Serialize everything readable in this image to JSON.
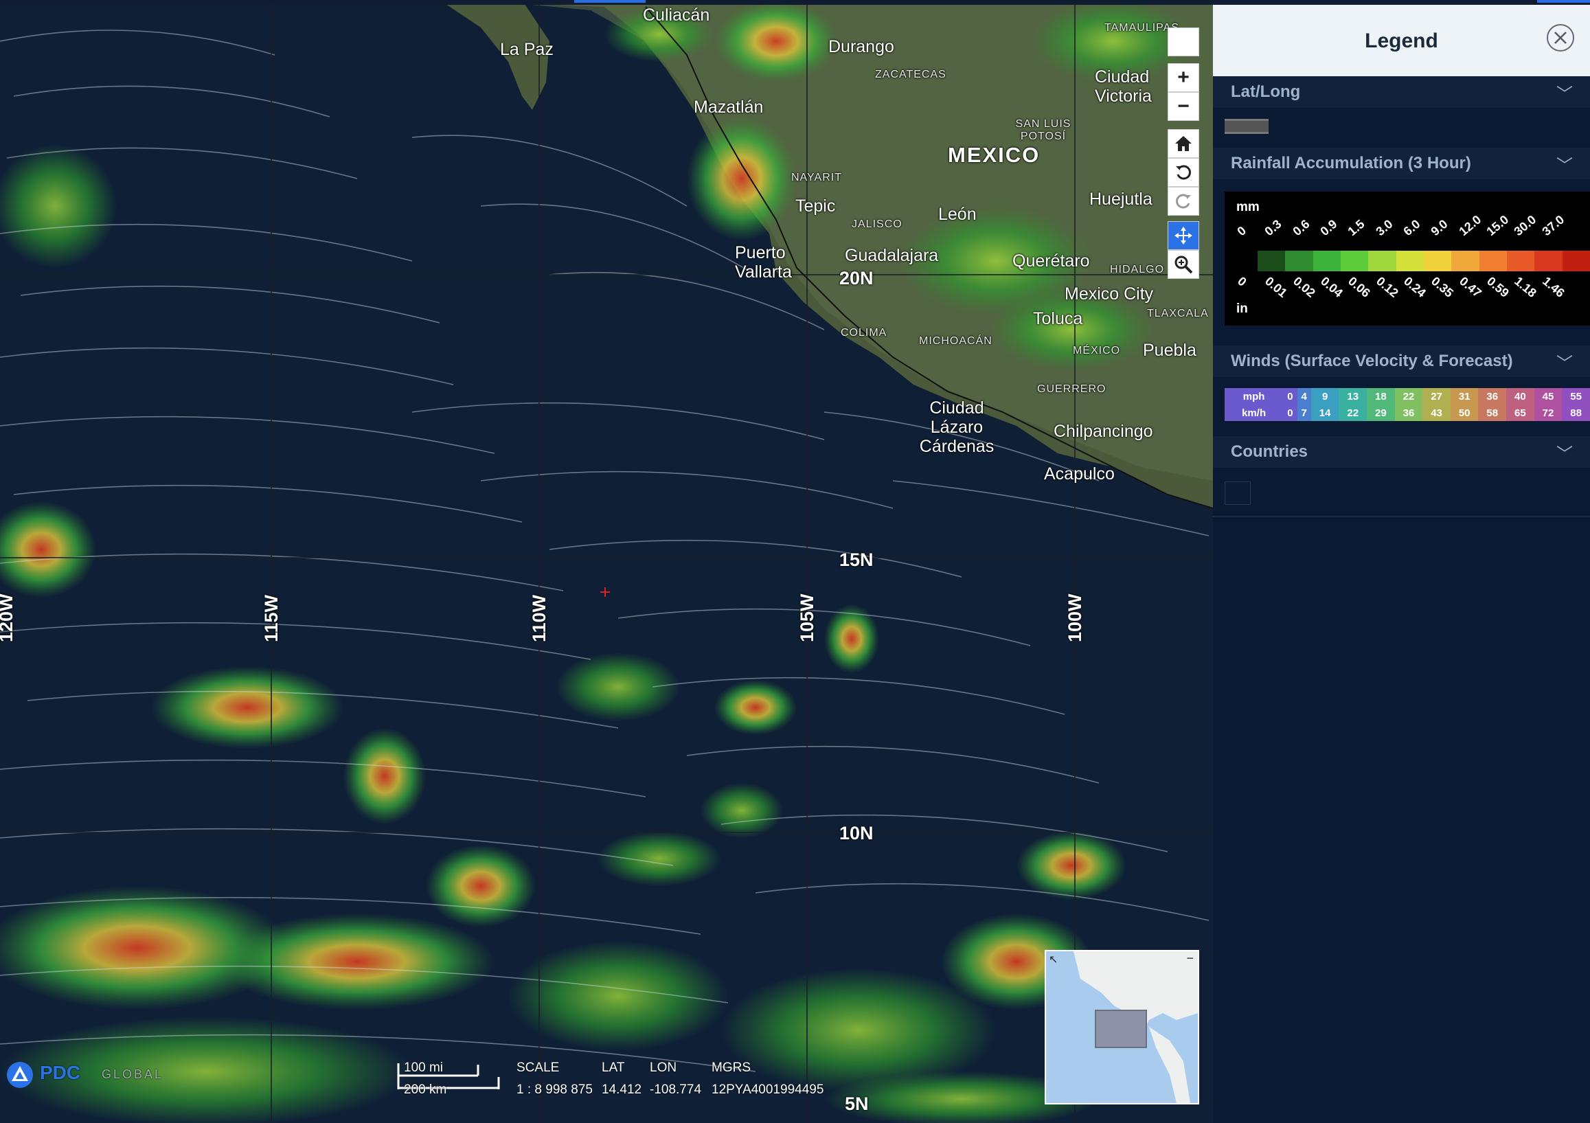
{
  "map": {
    "cities": [
      {
        "id": "culiacan",
        "name": "Culiacán"
      },
      {
        "id": "la-paz",
        "name": "La Paz"
      },
      {
        "id": "durango",
        "name": "Durango"
      },
      {
        "id": "mazatlan",
        "name": "Mazatlán"
      },
      {
        "id": "ciudad-victoria",
        "name": "Ciudad Victoria"
      },
      {
        "id": "tepic",
        "name": "Tepic"
      },
      {
        "id": "leon",
        "name": "León"
      },
      {
        "id": "huejutla",
        "name": "Huejutla"
      },
      {
        "id": "puerto-vallarta",
        "name": "Puerto Vallarta"
      },
      {
        "id": "guadalajara",
        "name": "Guadalajara"
      },
      {
        "id": "queretaro",
        "name": "Querétaro"
      },
      {
        "id": "mexico-city",
        "name": "Mexico City"
      },
      {
        "id": "toluca",
        "name": "Toluca"
      },
      {
        "id": "puebla",
        "name": "Puebla"
      },
      {
        "id": "ciudad-lazaro-cardenas",
        "name": "Ciudad Lázaro Cárdenas"
      },
      {
        "id": "chilpancingo",
        "name": "Chilpancingo"
      },
      {
        "id": "acapulco",
        "name": "Acapulco"
      }
    ],
    "states": [
      "TAMAULIPAS",
      "ZACATECAS",
      "SAN LUIS POTOSÍ",
      "NAYARIT",
      "JALISCO",
      "HIDALGO",
      "TLAXCALA",
      "COLIMA",
      "MICHOACÁN",
      "MÉXICO",
      "GUERRERO"
    ],
    "country": "MEXICO",
    "grid_labels": {
      "n20": "20N",
      "n15": "15N",
      "n10": "10N",
      "n5": "5N",
      "w120": "120W",
      "w115": "115W",
      "w110": "110W",
      "w105": "105W",
      "w100": "100W"
    }
  },
  "toolbar": {
    "buttons": [
      "blank",
      "zoom-in",
      "zoom-out",
      "home",
      "rotate-ccw",
      "rotate-cw",
      "pan",
      "zoom-box"
    ],
    "zoom_in_symbol": "+",
    "zoom_out_symbol": "−",
    "active": "pan"
  },
  "legend": {
    "title": "Legend",
    "sections": {
      "latlong": {
        "title": "Lat/Long"
      },
      "rainfall": {
        "title": "Rainfall Accumulation (3 Hour)",
        "unit_mm": "mm",
        "unit_in": "in",
        "mm_values": [
          "0",
          "0.3",
          "0.6",
          "0.9",
          "1.5",
          "3.0",
          "6.0",
          "9.0",
          "12.0",
          "15.0",
          "30.0",
          "37.0"
        ],
        "in_values": [
          "0",
          "0.01",
          "0.02",
          "0.04",
          "0.06",
          "0.12",
          "0.24",
          "0.35",
          "0.47",
          "0.59",
          "1.18",
          "1.46"
        ],
        "colors": [
          "#1a4d1a",
          "#2e8b2e",
          "#3bb33b",
          "#5dcc3b",
          "#9fd63b",
          "#d6e03b",
          "#f0d03b",
          "#f0a83b",
          "#f08030",
          "#e85a28",
          "#d83a20",
          "#c02010"
        ]
      },
      "winds": {
        "title": "Winds (Surface Velocity & Forecast)",
        "mph_label": "mph",
        "kmh_label": "km/h",
        "mph": [
          "0",
          "4",
          "9",
          "13",
          "18",
          "22",
          "27",
          "31",
          "36",
          "40",
          "45",
          "55"
        ],
        "kmh": [
          "0",
          "7",
          "14",
          "22",
          "29",
          "36",
          "43",
          "50",
          "58",
          "65",
          "72",
          "88"
        ],
        "colors": [
          "#6a5acd",
          "#4a7fd0",
          "#3a9fc0",
          "#3ab0a0",
          "#50b878",
          "#80c060",
          "#b0b050",
          "#c89850",
          "#c87860",
          "#c06080",
          "#b050a0",
          "#9050c0"
        ]
      },
      "countries": {
        "title": "Countries"
      }
    }
  },
  "status": {
    "scale_mi": "100 mi",
    "scale_km": "200 km",
    "scale_label": "SCALE",
    "scale_value": "1 : 8 998 875",
    "lat_label": "LAT",
    "lat_value": "14.412",
    "lon_label": "LON",
    "lon_value": "-108.774",
    "mgrs_label": "MGRS",
    "mgrs_value": "12PYA4001994495",
    "logo_text": "PDC",
    "logo_sub": "GLOBAL"
  }
}
